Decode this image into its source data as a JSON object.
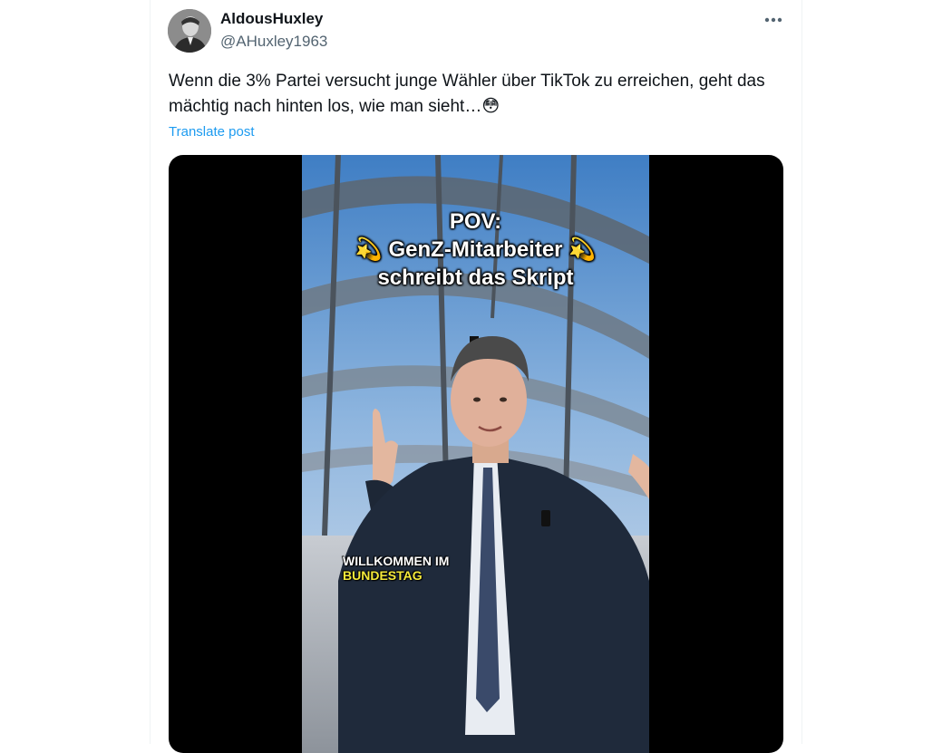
{
  "post": {
    "author_name": "AldousHuxley",
    "author_handle": "@AHuxley1963",
    "text": "Wenn die 3% Partei versucht junge Wähler über TikTok zu erreichen, geht das mächtig nach hinten los, wie man sieht…😳",
    "translate_label": "Translate post",
    "more_icon": "more-horizontal-icon"
  },
  "video": {
    "caption_line1": "POV:",
    "caption_line2": "GenZ-Mitarbeiter",
    "caption_line3": "schreibt das Skript",
    "sparkle_emoji": "💫",
    "overlay_line1": "WILLKOMMEN IM",
    "overlay_line2": "BUNDESTAG"
  },
  "colors": {
    "link": "#1d9bf0",
    "secondary_text": "#536471",
    "highlight_yellow": "#f5ea3b"
  }
}
